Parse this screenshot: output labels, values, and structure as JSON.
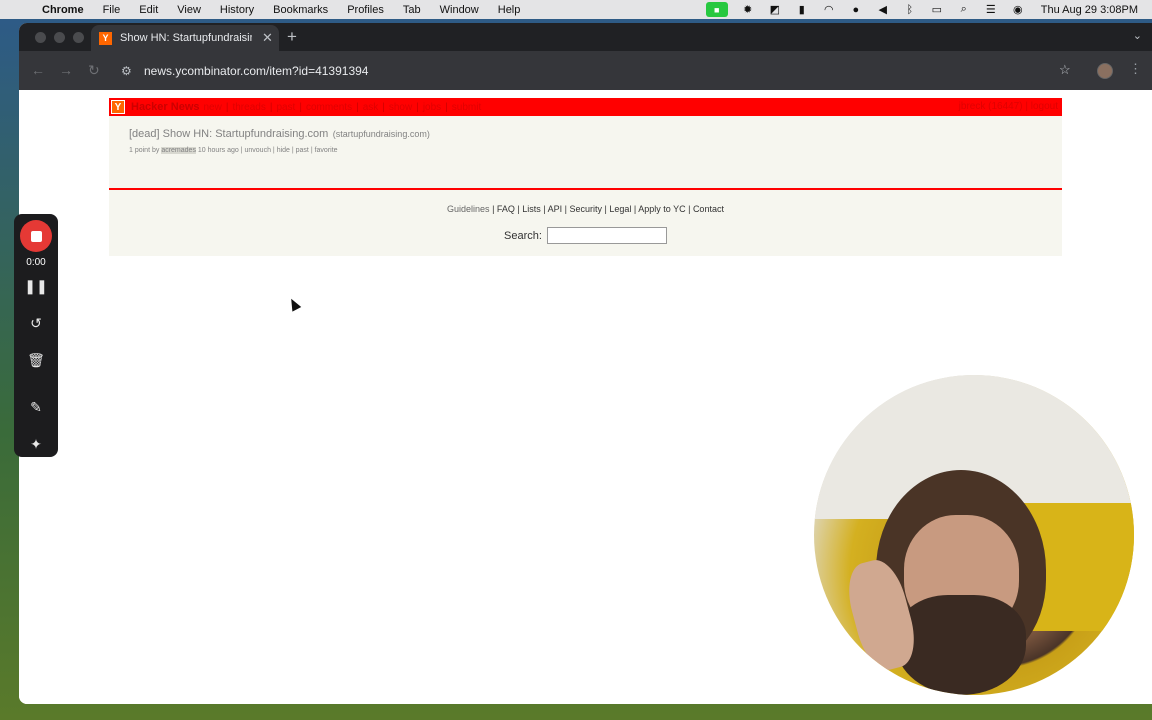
{
  "menubar": {
    "app": "Chrome",
    "items": [
      "File",
      "Edit",
      "View",
      "History",
      "Bookmarks",
      "Profiles",
      "Tab",
      "Window",
      "Help"
    ],
    "clock": "Thu Aug 29  3:08PM"
  },
  "browser": {
    "tab_title": "Show HN: Startupfundraising",
    "tab_favicon": "Y",
    "url": "news.ycombinator.com/item?id=41391394"
  },
  "hn": {
    "logo": "Y",
    "site_title": "Hacker News",
    "nav": [
      "new",
      "threads",
      "past",
      "comments",
      "ask",
      "show",
      "jobs",
      "submit"
    ],
    "user": "jbreck (16447)",
    "logout": "logout",
    "story": {
      "title": "[dead] Show HN: Startupfundraising.com",
      "site": "(startupfundraising.com)",
      "points": "1 point by",
      "user": "acremades",
      "age": "10 hours ago",
      "actions": [
        "unvouch",
        "hide",
        "past",
        "favorite"
      ]
    },
    "footer": {
      "links": [
        "Guidelines",
        "FAQ",
        "Lists",
        "API",
        "Security",
        "Legal",
        "Apply to YC",
        "Contact"
      ],
      "search_label": "Search:"
    }
  },
  "recorder": {
    "time": "0:00"
  }
}
